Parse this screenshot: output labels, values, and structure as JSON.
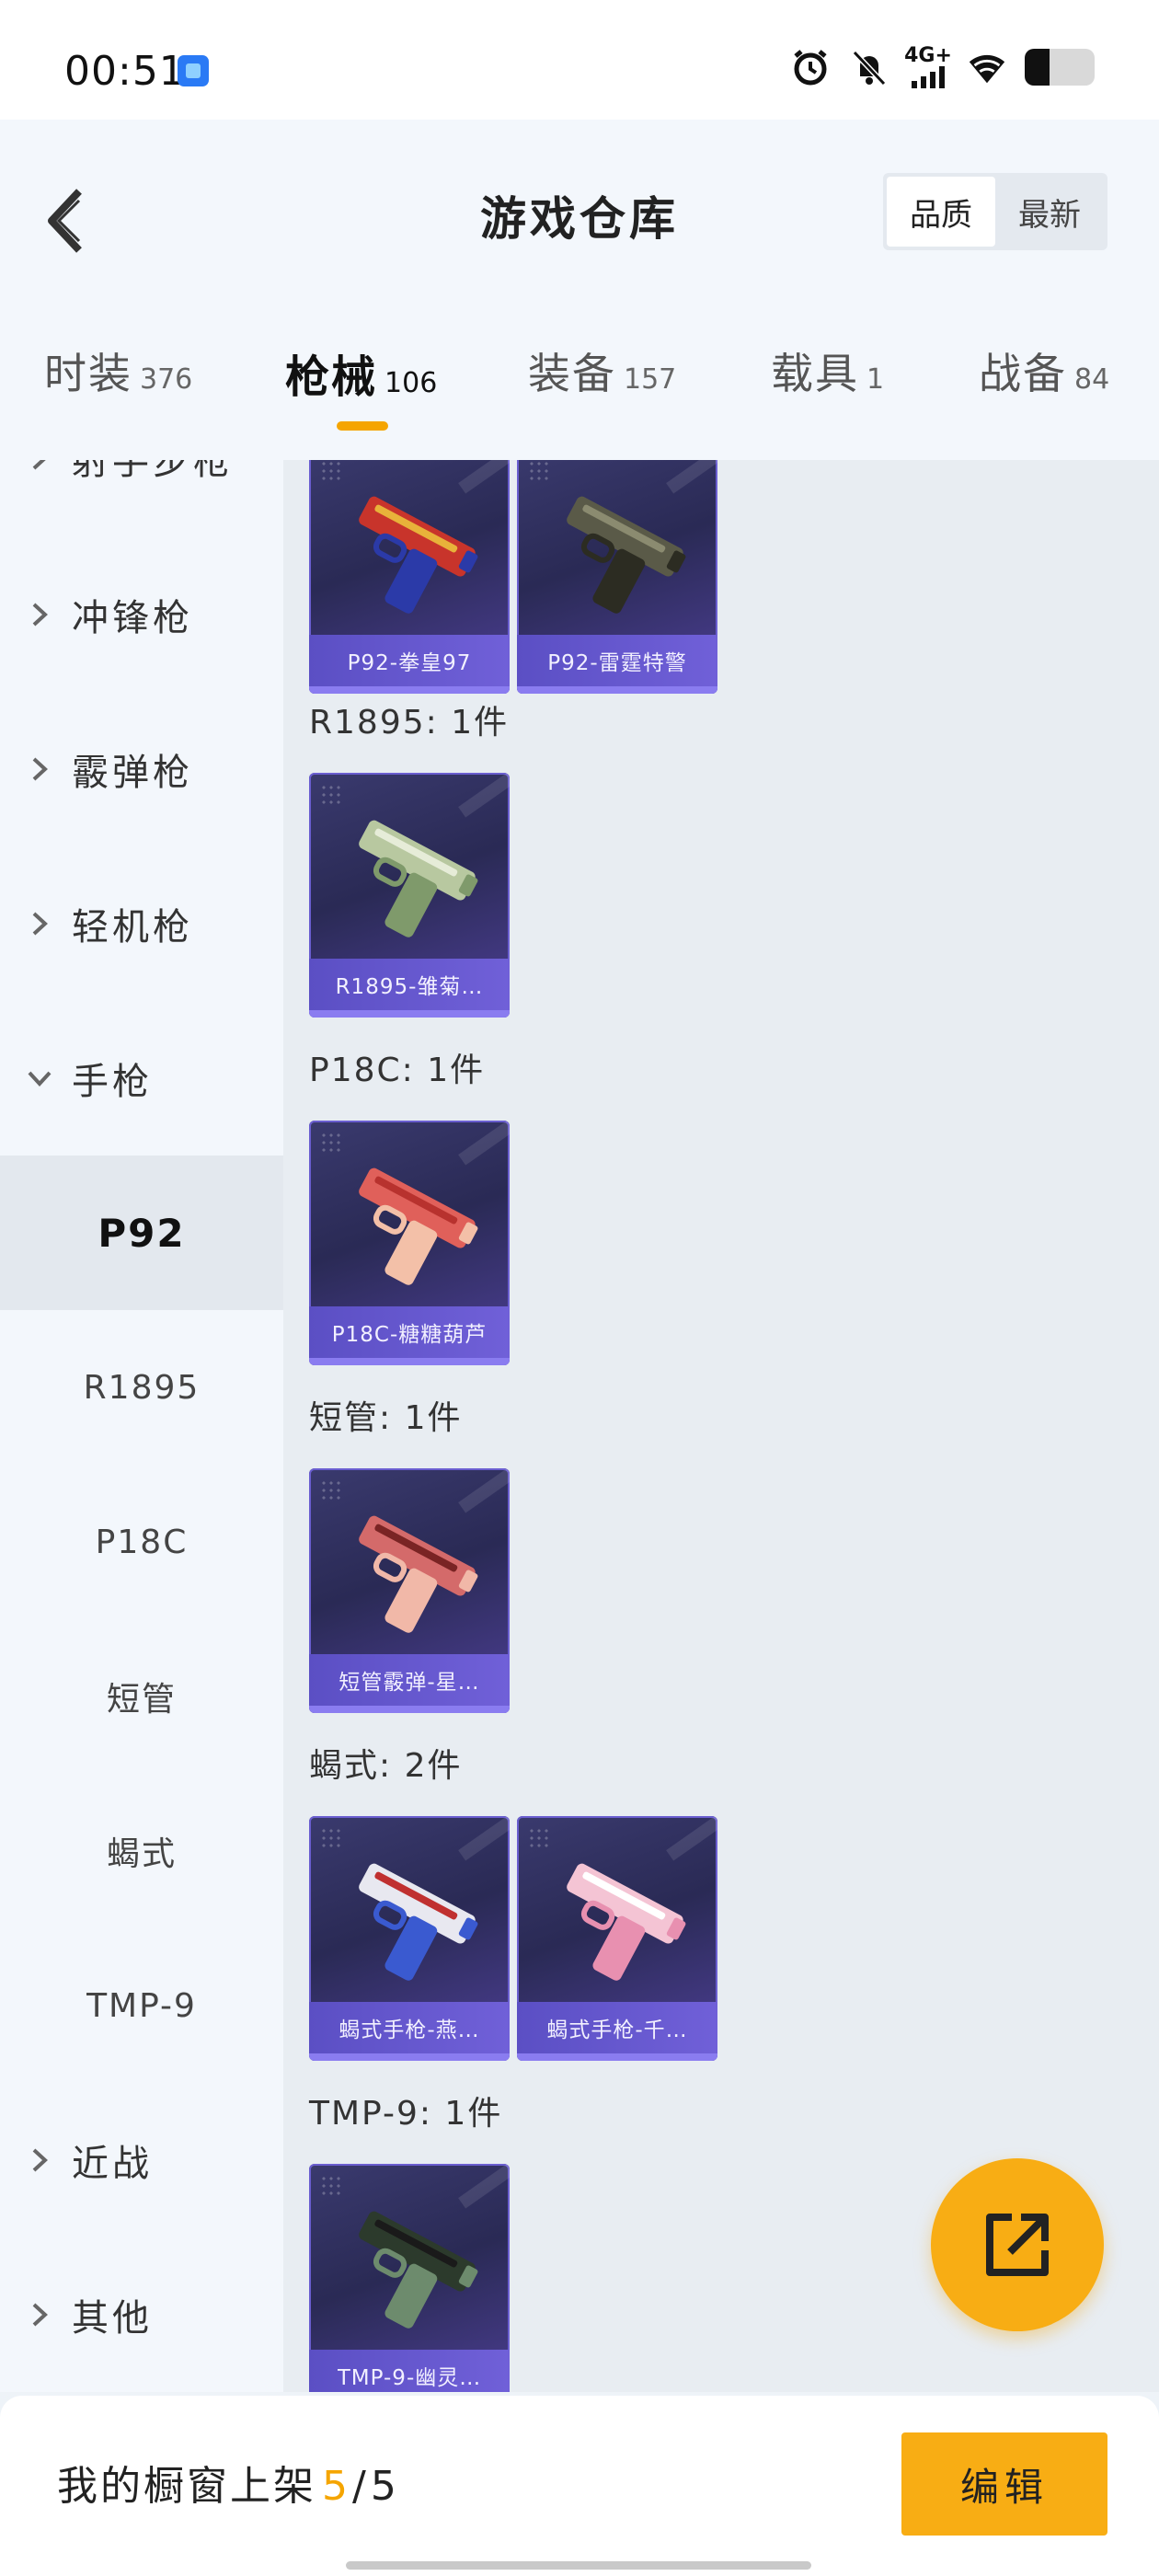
{
  "status_bar": {
    "time": "00:51",
    "network": "4G+",
    "battery_level": 0.35
  },
  "header": {
    "title": "游戏仓库",
    "sort_options": [
      "品质",
      "最新"
    ],
    "sort_selected": "品质"
  },
  "tabs": [
    {
      "label": "时装",
      "count": "376",
      "active": false
    },
    {
      "label": "枪械",
      "count": "106",
      "active": true
    },
    {
      "label": "装备",
      "count": "157",
      "active": false
    },
    {
      "label": "载具",
      "count": "1",
      "active": false
    },
    {
      "label": "战备",
      "count": "84",
      "active": false
    }
  ],
  "sidebar": {
    "categories": [
      {
        "label": "射手步枪",
        "expanded": false
      },
      {
        "label": "冲锋枪",
        "expanded": false
      },
      {
        "label": "霰弹枪",
        "expanded": false
      },
      {
        "label": "轻机枪",
        "expanded": false
      },
      {
        "label": "手枪",
        "expanded": true
      }
    ],
    "pistol_subitems": [
      "P92",
      "R1895",
      "P18C",
      "短管",
      "蝎式",
      "TMP-9"
    ],
    "pistol_selected": "P92",
    "categories_after": [
      {
        "label": "近战"
      },
      {
        "label": "其他"
      }
    ]
  },
  "content": {
    "groups": [
      {
        "title": "",
        "items": [
          {
            "name": "P92-拳皇97",
            "colors": [
              "#c8342b",
              "#2b3aa8",
              "#e8b23a"
            ]
          },
          {
            "name": "P92-雷霆特警",
            "colors": [
              "#5a5a48",
              "#2c2c22",
              "#8b8b70"
            ]
          }
        ]
      },
      {
        "title": "R1895: 1件",
        "items": [
          {
            "name": "R1895-雏菊…",
            "colors": [
              "#b8c8a0",
              "#7f9a6b",
              "#e6ecd8"
            ]
          }
        ]
      },
      {
        "title": "P18C: 1件",
        "items": [
          {
            "name": "P18C-糖糖葫芦",
            "colors": [
              "#e0605a",
              "#f3c0a8",
              "#b8322e"
            ]
          }
        ]
      },
      {
        "title": "短管: 1件",
        "items": [
          {
            "name": "短管霰弹-星…",
            "colors": [
              "#d46a6a",
              "#f1b8a8",
              "#7a2424"
            ]
          }
        ]
      },
      {
        "title": "蝎式: 2件",
        "items": [
          {
            "name": "蝎式手枪-燕…",
            "colors": [
              "#e8e8f0",
              "#3a5ad0",
              "#c03030"
            ]
          },
          {
            "name": "蝎式手枪-千…",
            "colors": [
              "#f4c4d4",
              "#e890b0",
              "#ffffff"
            ]
          }
        ]
      },
      {
        "title": "TMP-9: 1件",
        "items": [
          {
            "name": "TMP-9-幽灵…",
            "colors": [
              "#2c3a2c",
              "#6d8b6d",
              "#1a1a1a"
            ]
          }
        ]
      }
    ]
  },
  "bottom_bar": {
    "shelf_label": "我的橱窗上架",
    "shelf_current": "5",
    "shelf_total": "5",
    "edit_label": "编辑"
  },
  "colors": {
    "accent": "#f8ad14",
    "card_band": "#6a5ed0"
  }
}
